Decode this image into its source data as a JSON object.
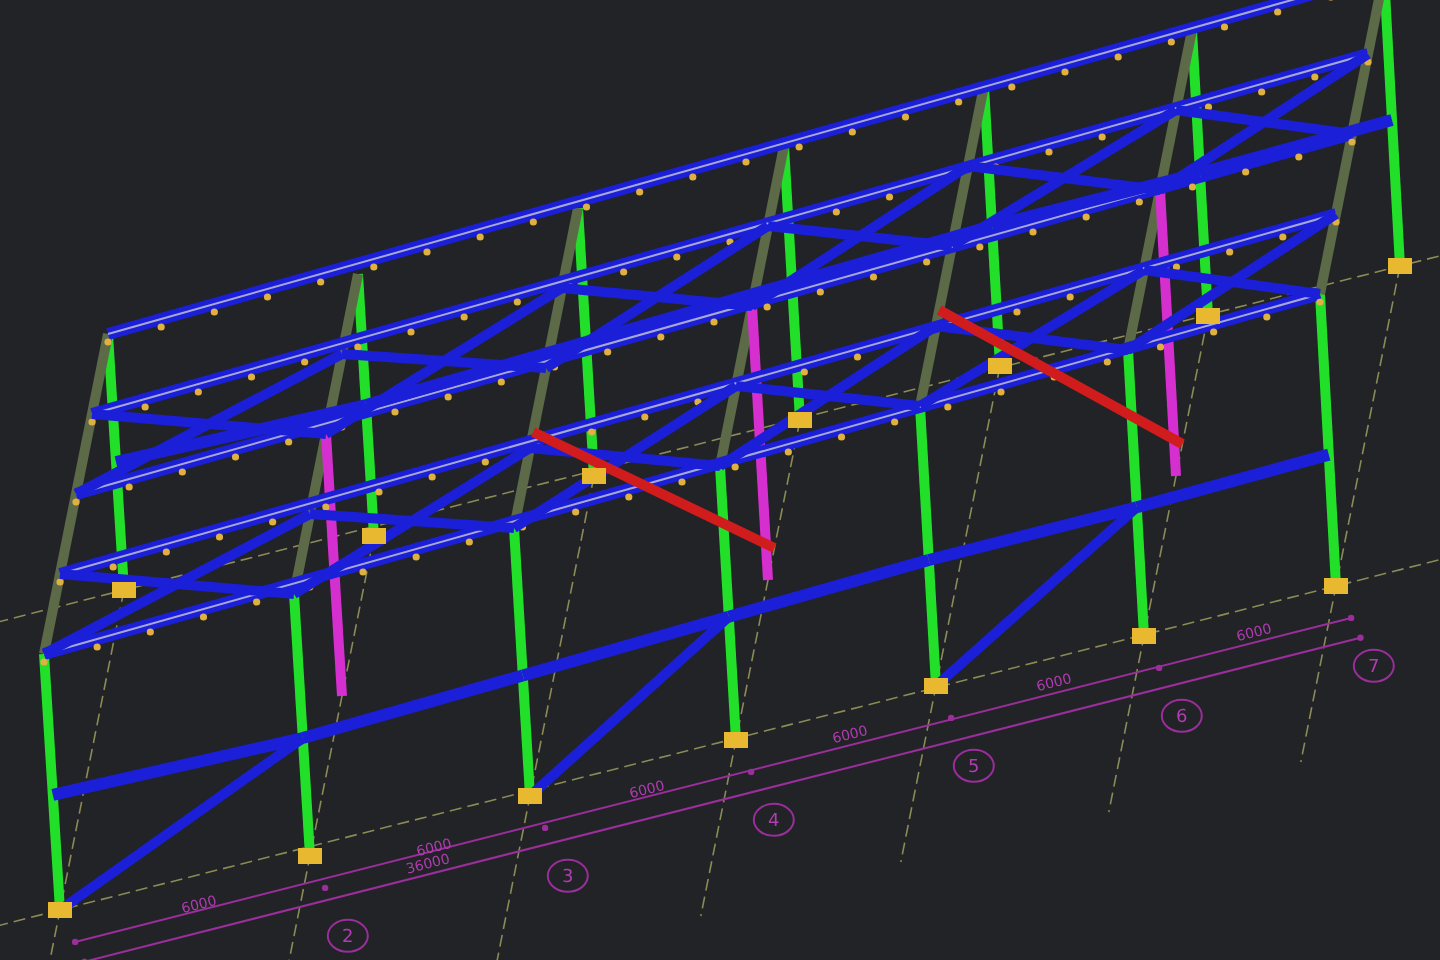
{
  "viewport": {
    "grid_labels": [
      "2",
      "3",
      "4",
      "5",
      "6",
      "7"
    ],
    "bay_dimensions": [
      "6000",
      "6000",
      "6000",
      "6000",
      "6000",
      "6000"
    ],
    "total_dimension": "36000"
  }
}
